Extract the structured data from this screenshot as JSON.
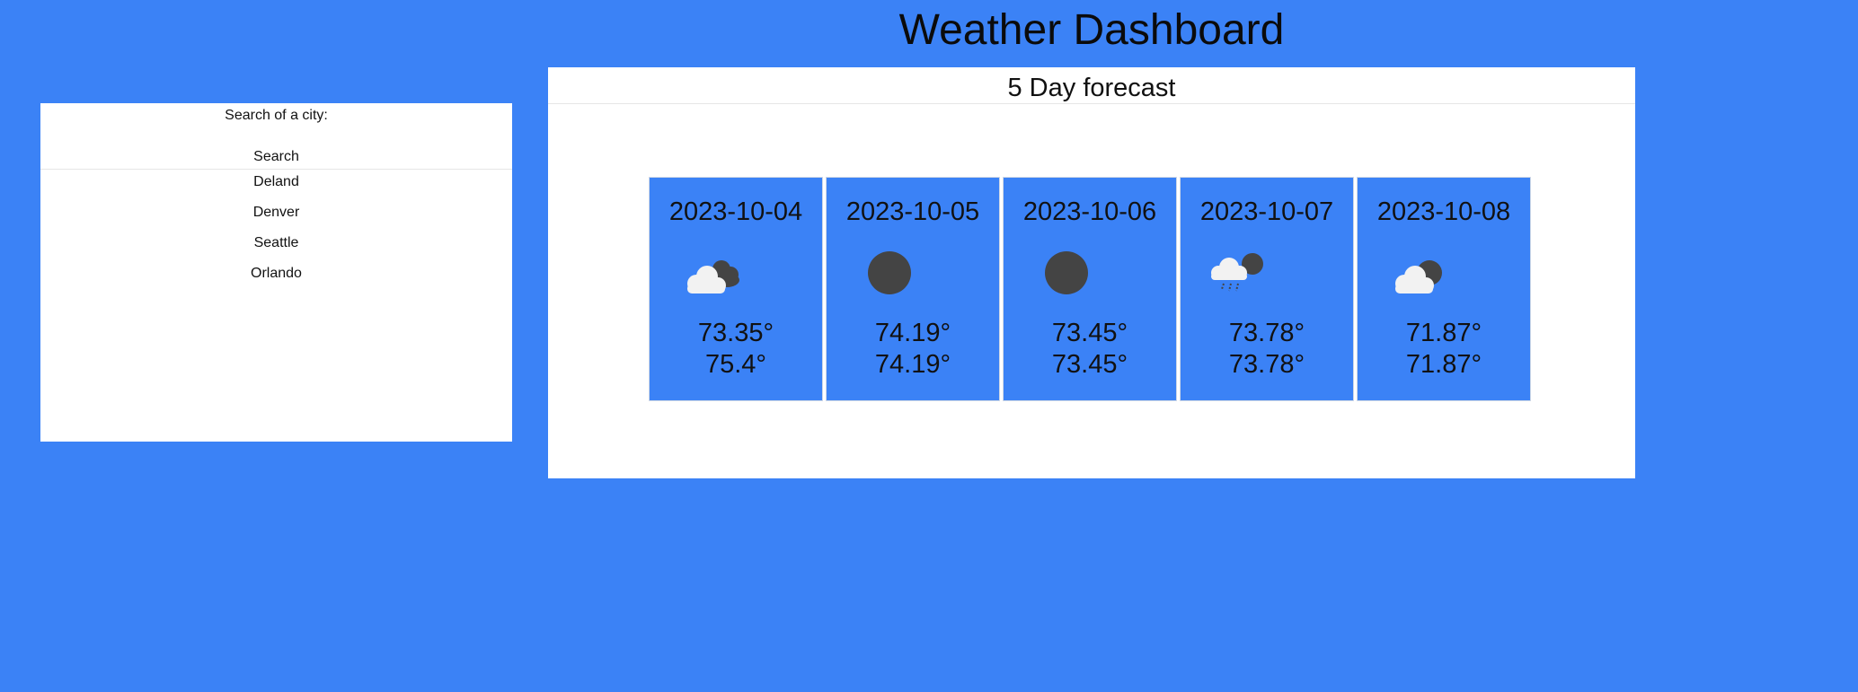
{
  "page": {
    "title": "Weather Dashboard"
  },
  "sidebar": {
    "search_label": "Search of a city:",
    "search_input_value": "",
    "search_button_label": "Search",
    "history": [
      {
        "label": "Deland"
      },
      {
        "label": "Denver"
      },
      {
        "label": "Seattle"
      },
      {
        "label": "Orlando"
      }
    ]
  },
  "forecast": {
    "title": "5 Day forecast",
    "days": [
      {
        "date": "2023-10-04",
        "icon": "partly-cloudy-icon",
        "temp_1": "73.35°",
        "temp_2": "75.4°"
      },
      {
        "date": "2023-10-05",
        "icon": "clear-night-icon",
        "temp_1": "74.19°",
        "temp_2": "74.19°"
      },
      {
        "date": "2023-10-06",
        "icon": "clear-night-icon",
        "temp_1": "73.45°",
        "temp_2": "73.45°"
      },
      {
        "date": "2023-10-07",
        "icon": "rain-night-icon",
        "temp_1": "73.78°",
        "temp_2": "73.78°"
      },
      {
        "date": "2023-10-08",
        "icon": "cloudy-night-icon",
        "temp_1": "71.87°",
        "temp_2": "71.87°"
      }
    ]
  },
  "colors": {
    "background": "#3b82f6",
    "panel": "#ffffff",
    "card": "#3b82f6",
    "icon_dark": "#444444",
    "icon_cloud": "#f2f2f2"
  }
}
